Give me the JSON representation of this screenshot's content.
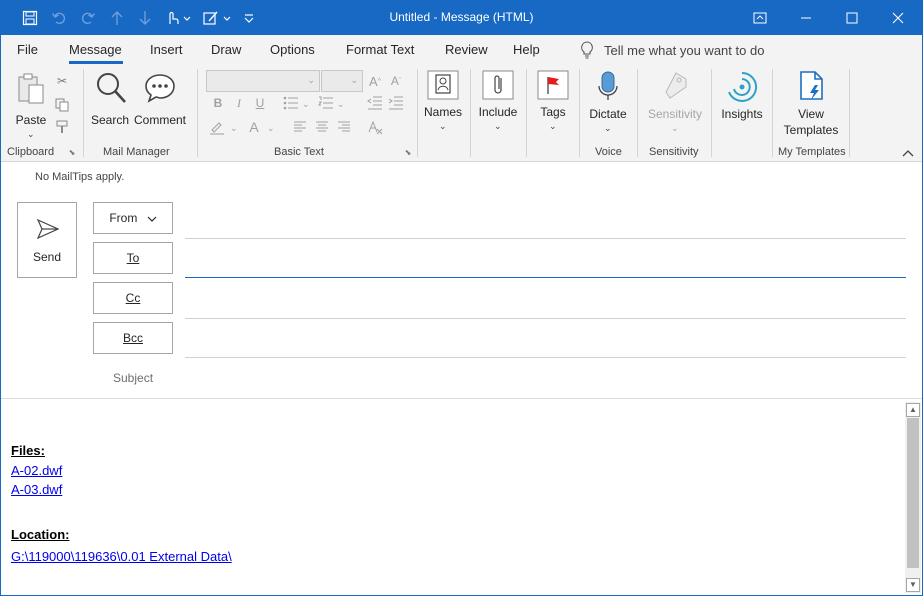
{
  "window": {
    "title": "Untitled  -  Message (HTML)"
  },
  "menu": {
    "tabs": [
      {
        "label": "File"
      },
      {
        "label": "Message"
      },
      {
        "label": "Insert"
      },
      {
        "label": "Draw"
      },
      {
        "label": "Options"
      },
      {
        "label": "Format Text"
      },
      {
        "label": "Review"
      },
      {
        "label": "Help"
      }
    ],
    "active_tab": "Message",
    "tell_me": "Tell me what you want to do"
  },
  "ribbon": {
    "clipboard": {
      "paste": "Paste",
      "group": "Clipboard"
    },
    "mail_manager": {
      "search": "Search",
      "comment": "Comment",
      "group": "Mail Manager"
    },
    "basic_text": {
      "group": "Basic Text"
    },
    "names": {
      "label": "Names"
    },
    "include": {
      "label": "Include"
    },
    "tags": {
      "label": "Tags"
    },
    "voice": {
      "dictate": "Dictate",
      "group": "Voice"
    },
    "sensitivity": {
      "label": "Sensitivity",
      "group": "Sensitivity"
    },
    "insights": {
      "label": "Insights"
    },
    "templates": {
      "view_line1": "View",
      "view_line2": "Templates",
      "group": "My Templates"
    }
  },
  "compose": {
    "mailtips": "No MailTips apply.",
    "send": "Send",
    "from": "From",
    "to": "To",
    "cc": "Cc",
    "bcc": "Bcc",
    "subject": "Subject"
  },
  "body": {
    "files_heading": "Files:",
    "files": [
      "A-02.dwf",
      "A-03.dwf"
    ],
    "location_heading": "Location:",
    "location_path": "G:\\119000\\119636\\0.01 External Data\\"
  },
  "colors": {
    "accent": "#1769c4",
    "link": "#0000ee"
  }
}
